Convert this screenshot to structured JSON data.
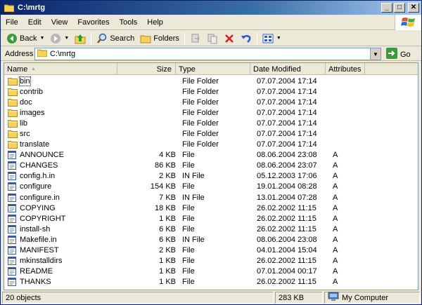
{
  "window": {
    "title": "C:\\mrtg",
    "minimize": "_",
    "maximize": "□",
    "close": "✕"
  },
  "menu": [
    "File",
    "Edit",
    "View",
    "Favorites",
    "Tools",
    "Help"
  ],
  "toolbar": {
    "back_label": "Back",
    "search_label": "Search",
    "folders_label": "Folders"
  },
  "address": {
    "label": "Address",
    "value": "C:\\mrtg",
    "go_label": "Go"
  },
  "columns": {
    "name": "Name",
    "size": "Size",
    "type": "Type",
    "date": "Date Modified",
    "attributes": "Attributes"
  },
  "files": [
    {
      "name": "bin",
      "size": "",
      "type": "File Folder",
      "date": "07.07.2004 17:14",
      "attr": "",
      "kind": "folder"
    },
    {
      "name": "contrib",
      "size": "",
      "type": "File Folder",
      "date": "07.07.2004 17:14",
      "attr": "",
      "kind": "folder"
    },
    {
      "name": "doc",
      "size": "",
      "type": "File Folder",
      "date": "07.07.2004 17:14",
      "attr": "",
      "kind": "folder"
    },
    {
      "name": "images",
      "size": "",
      "type": "File Folder",
      "date": "07.07.2004 17:14",
      "attr": "",
      "kind": "folder"
    },
    {
      "name": "lib",
      "size": "",
      "type": "File Folder",
      "date": "07.07.2004 17:14",
      "attr": "",
      "kind": "folder"
    },
    {
      "name": "src",
      "size": "",
      "type": "File Folder",
      "date": "07.07.2004 17:14",
      "attr": "",
      "kind": "folder"
    },
    {
      "name": "translate",
      "size": "",
      "type": "File Folder",
      "date": "07.07.2004 17:14",
      "attr": "",
      "kind": "folder"
    },
    {
      "name": "ANNOUNCE",
      "size": "4 KB",
      "type": "File",
      "date": "08.06.2004 23:08",
      "attr": "A",
      "kind": "file"
    },
    {
      "name": "CHANGES",
      "size": "86 KB",
      "type": "File",
      "date": "08.06.2004 23:07",
      "attr": "A",
      "kind": "file"
    },
    {
      "name": "config.h.in",
      "size": "2 KB",
      "type": "IN File",
      "date": "05.12.2003 17:06",
      "attr": "A",
      "kind": "file"
    },
    {
      "name": "configure",
      "size": "154 KB",
      "type": "File",
      "date": "19.01.2004 08:28",
      "attr": "A",
      "kind": "file"
    },
    {
      "name": "configure.in",
      "size": "7 KB",
      "type": "IN File",
      "date": "13.01.2004 07:28",
      "attr": "A",
      "kind": "file"
    },
    {
      "name": "COPYING",
      "size": "18 KB",
      "type": "File",
      "date": "26.02.2002 11:15",
      "attr": "A",
      "kind": "file"
    },
    {
      "name": "COPYRIGHT",
      "size": "1 KB",
      "type": "File",
      "date": "26.02.2002 11:15",
      "attr": "A",
      "kind": "file"
    },
    {
      "name": "install-sh",
      "size": "6 KB",
      "type": "File",
      "date": "26.02.2002 11:15",
      "attr": "A",
      "kind": "file"
    },
    {
      "name": "Makefile.in",
      "size": "6 KB",
      "type": "IN File",
      "date": "08.06.2004 23:08",
      "attr": "A",
      "kind": "file"
    },
    {
      "name": "MANIFEST",
      "size": "2 KB",
      "type": "File",
      "date": "04.01.2004 15:04",
      "attr": "A",
      "kind": "file"
    },
    {
      "name": "mkinstalldirs",
      "size": "1 KB",
      "type": "File",
      "date": "26.02.2002 11:15",
      "attr": "A",
      "kind": "file"
    },
    {
      "name": "README",
      "size": "1 KB",
      "type": "File",
      "date": "07.01.2004 00:17",
      "attr": "A",
      "kind": "file"
    },
    {
      "name": "THANKS",
      "size": "1 KB",
      "type": "File",
      "date": "26.02.2002 11:15",
      "attr": "A",
      "kind": "file"
    }
  ],
  "status": {
    "objects": "20 objects",
    "size": "283 KB",
    "zone": "My Computer"
  },
  "colors": {
    "title_start": "#0a246a",
    "title_end": "#a6caf0",
    "folder": "#f5d25a",
    "chrome": "#ece9d8"
  }
}
